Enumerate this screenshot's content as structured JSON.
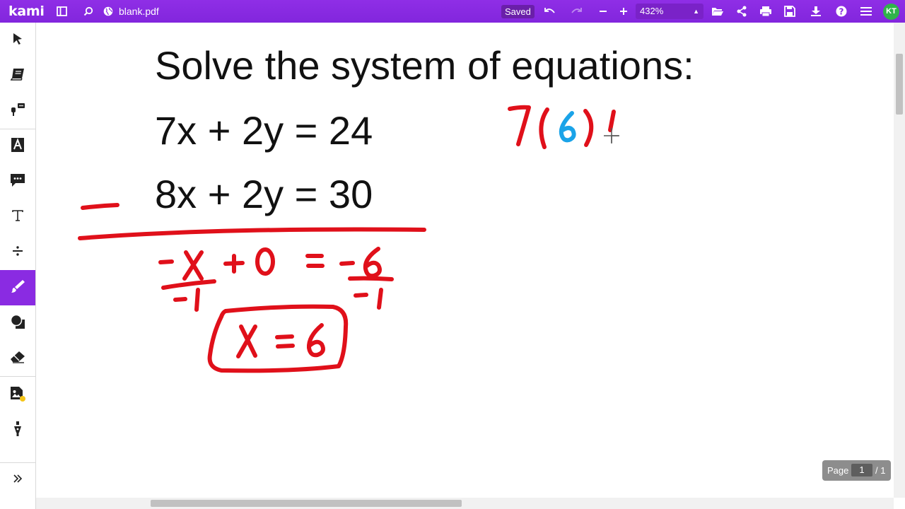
{
  "app": {
    "logo_text": "kami",
    "file_name": "blank.pdf",
    "saved_label": "Saved",
    "zoom_value": "432%",
    "user_initials": "KT",
    "accent_color": "#8a2be2",
    "avatar_color": "#2fb34a"
  },
  "topbar_icons": [
    "sidebar-toggle-icon",
    "search-icon",
    "globe-icon",
    "undo-icon",
    "redo-icon",
    "zoom-out-icon",
    "zoom-in-icon",
    "open-folder-icon",
    "share-icon",
    "print-icon",
    "save-icon",
    "download-icon",
    "help-icon",
    "menu-icon"
  ],
  "tools": [
    "select-icon",
    "dictionary-icon",
    "text-to-speech-icon",
    "markup-icon",
    "comment-icon",
    "text-icon",
    "equation-icon",
    "drawing-icon",
    "shapes-icon",
    "eraser-icon",
    "add-media-icon",
    "signature-icon",
    "expand-icon"
  ],
  "active_tool": "drawing-icon",
  "document": {
    "heading": "Solve the system of equations:",
    "equation_1": "7x + 2y = 24",
    "equation_2": "8x + 2y = 30"
  },
  "annotations": {
    "ink_color_red": "#e0101a",
    "ink_color_blue": "#1aa3e8",
    "handwritten": [
      "−",
      "−x + 0 = −6",
      "−1",
      "−1",
      "x = 6",
      "7(6)"
    ]
  },
  "pagination": {
    "label": "Page",
    "current_page": "1",
    "total": "/ 1"
  }
}
